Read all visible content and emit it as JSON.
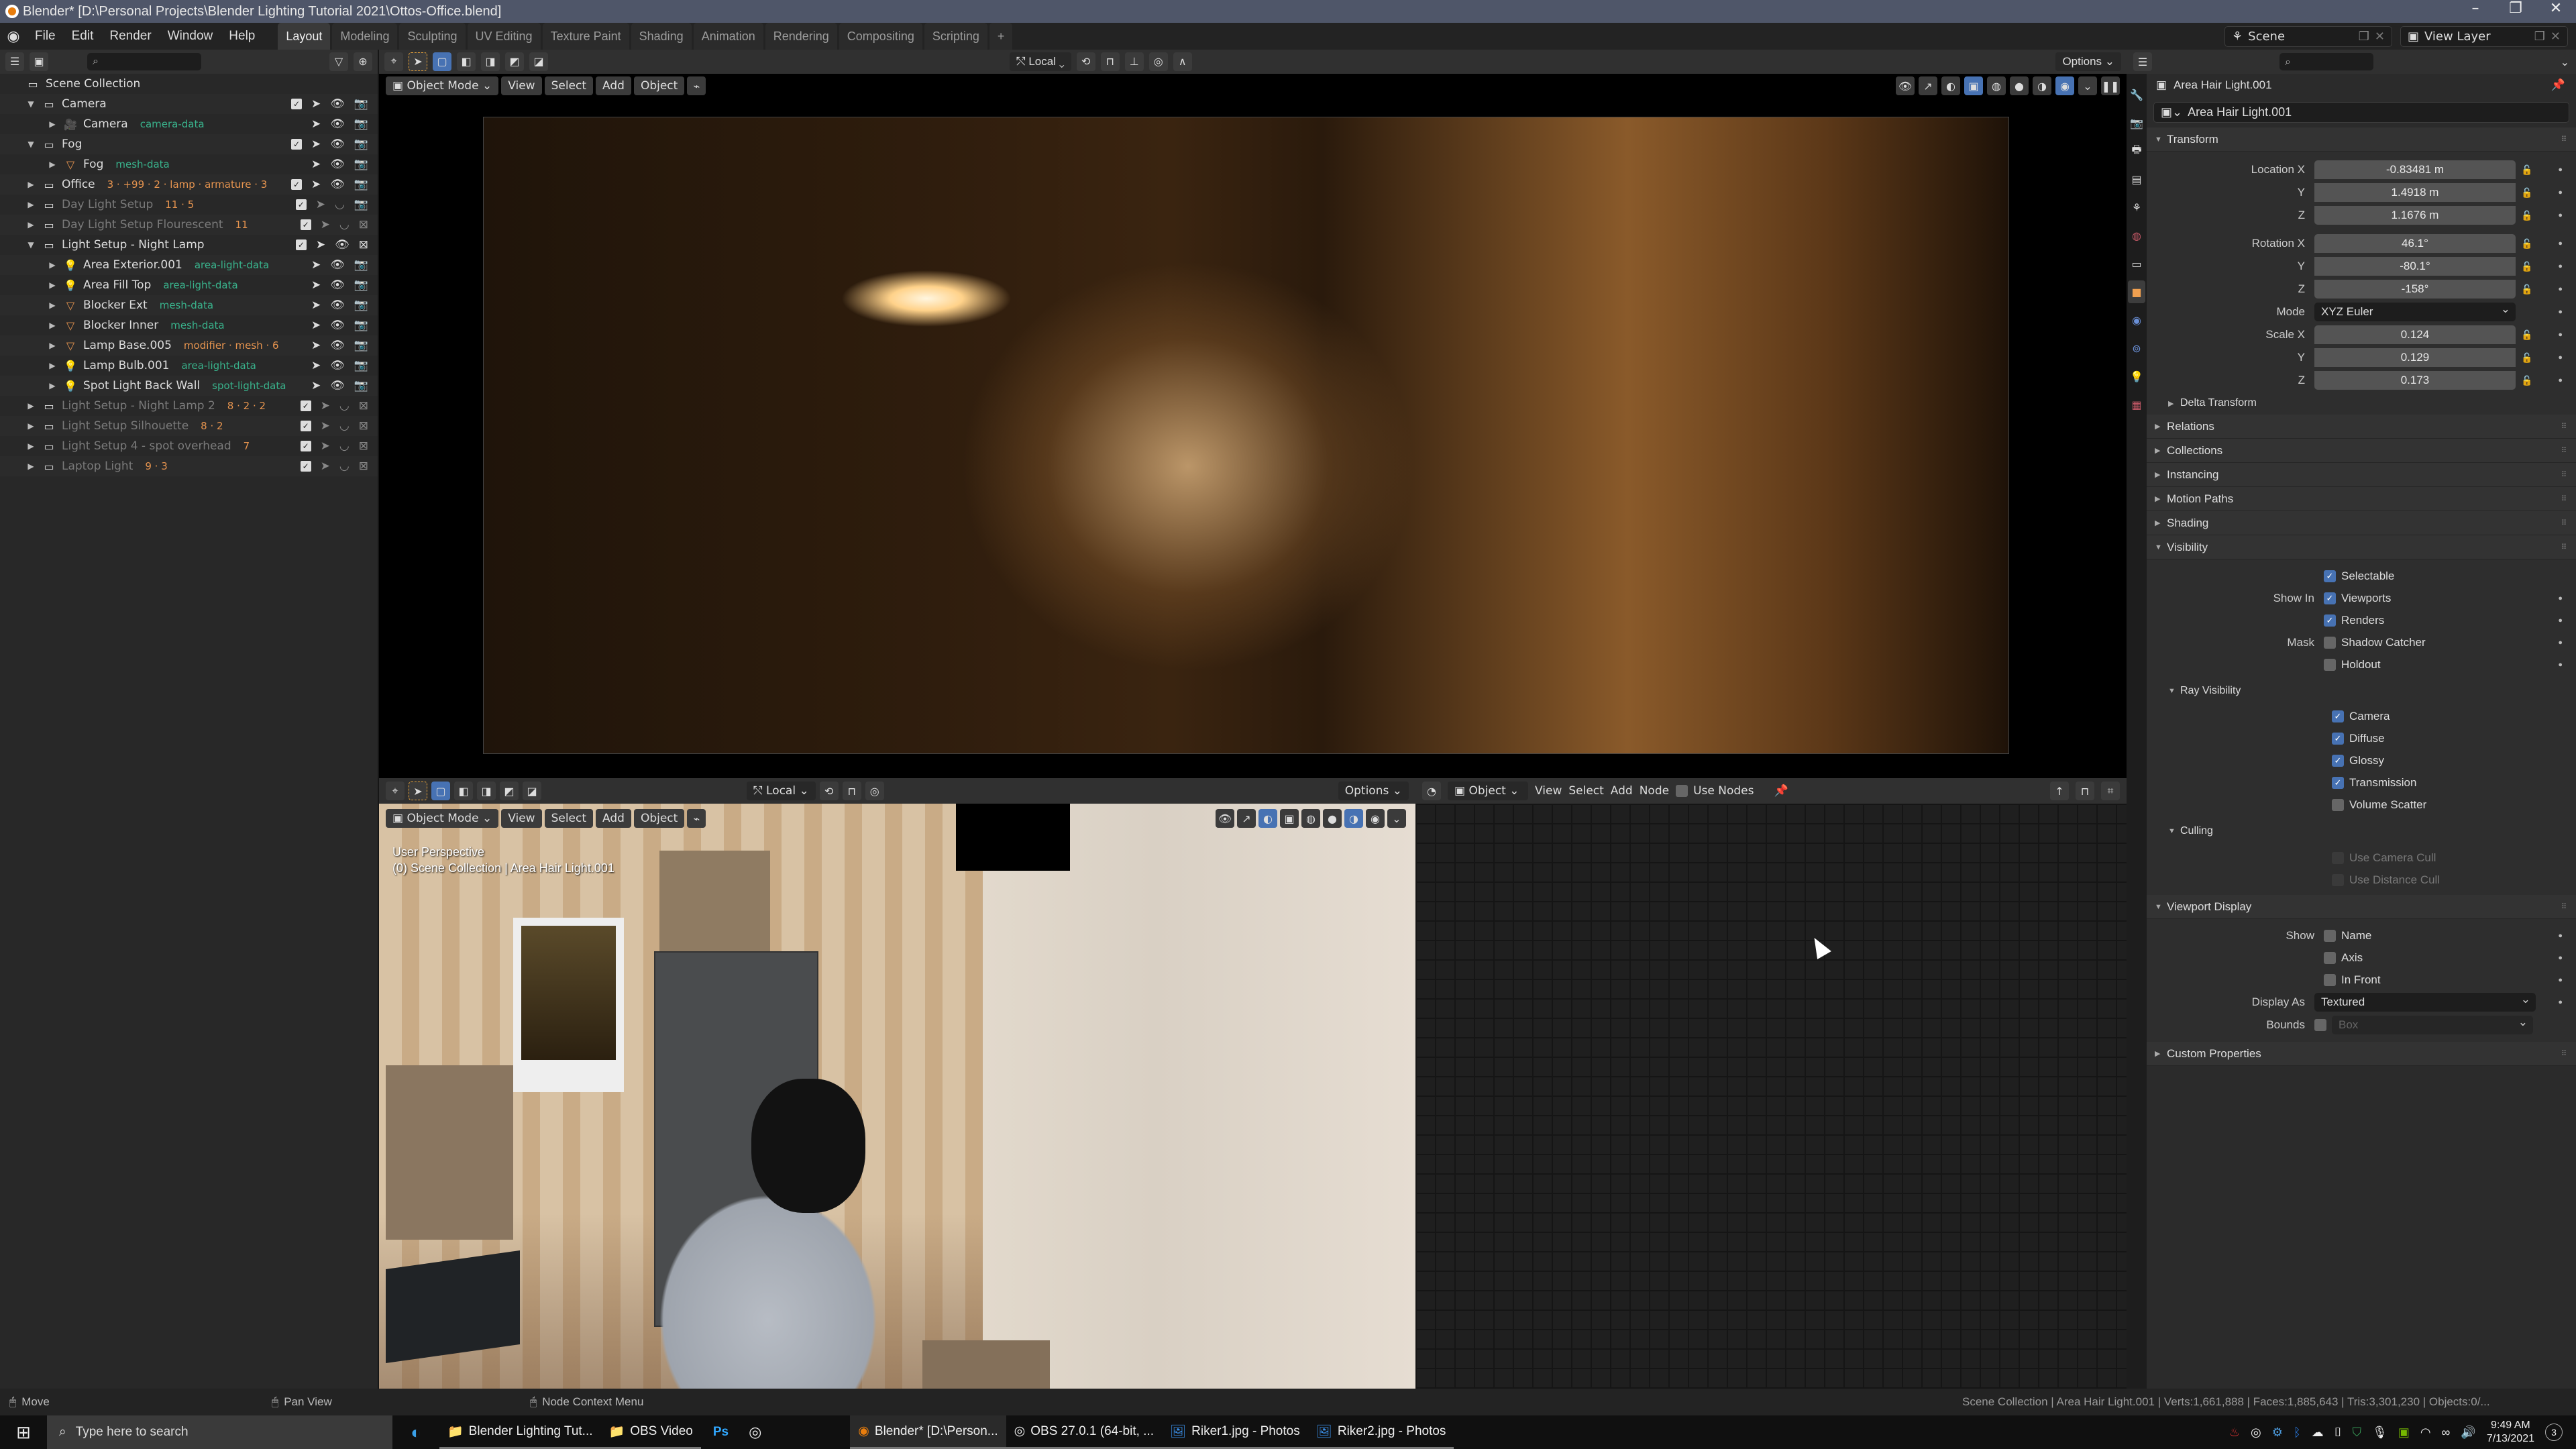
{
  "window": {
    "title": "Blender* [D:\\Personal Projects\\Blender Lighting Tutorial 2021\\Ottos-Office.blend]",
    "controls": [
      "–",
      "❐",
      "✕"
    ]
  },
  "menubar": {
    "menus": [
      "File",
      "Edit",
      "Render",
      "Window",
      "Help"
    ],
    "workspaces": [
      "Layout",
      "Modeling",
      "Sculpting",
      "UV Editing",
      "Texture Paint",
      "Shading",
      "Animation",
      "Rendering",
      "Compositing",
      "Scripting"
    ],
    "active_workspace": "Layout",
    "add_workspace": "+",
    "scene": "Scene",
    "view_layer": "View Layer"
  },
  "outliner": {
    "root": "Scene Collection",
    "rows": [
      {
        "label": "Camera",
        "type": "collection",
        "expand": "▼",
        "depth": 0,
        "dim": false,
        "badges": "",
        "checkbox": true,
        "render": "📷"
      },
      {
        "label": "Camera",
        "type": "camera",
        "expand": "▶",
        "depth": 1,
        "dim": false,
        "badges": "camera-data",
        "checkbox": false,
        "render": "📷"
      },
      {
        "label": "Fog",
        "type": "collection",
        "expand": "▼",
        "depth": 0,
        "dim": false,
        "badges": "",
        "checkbox": true,
        "render": "📷"
      },
      {
        "label": "Fog",
        "type": "mesh",
        "expand": "▶",
        "depth": 1,
        "dim": false,
        "badges": "mesh-data",
        "checkbox": false,
        "render": "📷"
      },
      {
        "label": "Office",
        "type": "collection",
        "expand": "▶",
        "depth": 0,
        "dim": false,
        "badges": "3 · +99 · 2 · lamp · armature · 3",
        "checkbox": true,
        "render": "📷"
      },
      {
        "label": "Day Light Setup",
        "type": "collection",
        "expand": "▶",
        "depth": 0,
        "dim": true,
        "badges": "11 · 5",
        "checkbox": true,
        "render": "📷"
      },
      {
        "label": "Day Light Setup Flourescent",
        "type": "collection",
        "expand": "▶",
        "depth": 0,
        "dim": true,
        "badges": "11",
        "checkbox": true,
        "render": "⊠"
      },
      {
        "label": "Light Setup - Night Lamp",
        "type": "collection",
        "expand": "▼",
        "depth": 0,
        "dim": false,
        "badges": "",
        "checkbox": true,
        "render": "⊠"
      },
      {
        "label": "Area Exterior.001",
        "type": "light",
        "expand": "▶",
        "depth": 1,
        "dim": false,
        "badges": "area-light-data",
        "checkbox": false,
        "render": "📷"
      },
      {
        "label": "Area Fill Top",
        "type": "light",
        "expand": "▶",
        "depth": 1,
        "dim": false,
        "badges": "area-light-data",
        "checkbox": false,
        "render": "📷"
      },
      {
        "label": "Blocker Ext",
        "type": "mesh",
        "expand": "▶",
        "depth": 1,
        "dim": false,
        "badges": "mesh-data",
        "checkbox": false,
        "render": "📷"
      },
      {
        "label": "Blocker Inner",
        "type": "mesh",
        "expand": "▶",
        "depth": 1,
        "dim": false,
        "badges": "mesh-data",
        "checkbox": false,
        "render": "📷"
      },
      {
        "label": "Lamp Base.005",
        "type": "mesh",
        "expand": "▶",
        "depth": 1,
        "dim": false,
        "badges": "modifier · mesh · 6",
        "checkbox": false,
        "render": "📷"
      },
      {
        "label": "Lamp Bulb.001",
        "type": "light",
        "expand": "▶",
        "depth": 1,
        "dim": false,
        "badges": "area-light-data",
        "checkbox": false,
        "render": "📷"
      },
      {
        "label": "Spot Light Back Wall",
        "type": "light",
        "expand": "▶",
        "depth": 1,
        "dim": false,
        "badges": "spot-light-data",
        "checkbox": false,
        "render": "📷"
      },
      {
        "label": "Light Setup - Night Lamp 2",
        "type": "collection",
        "expand": "▶",
        "depth": 0,
        "dim": true,
        "badges": "8 · 2 · 2",
        "checkbox": true,
        "render": "⊠"
      },
      {
        "label": "Light Setup Silhouette",
        "type": "collection",
        "expand": "▶",
        "depth": 0,
        "dim": true,
        "badges": "8 · 2",
        "checkbox": true,
        "render": "⊠"
      },
      {
        "label": "Light Setup 4 - spot overhead",
        "type": "collection",
        "expand": "▶",
        "depth": 0,
        "dim": true,
        "badges": "7",
        "checkbox": true,
        "render": "⊠"
      },
      {
        "label": "Laptop Light",
        "type": "collection",
        "expand": "▶",
        "depth": 0,
        "dim": true,
        "badges": "9 · 3",
        "checkbox": true,
        "render": "⊠"
      }
    ]
  },
  "top_viewport": {
    "transform_orientation": "Local",
    "options": "Options",
    "mode": "Object Mode",
    "menus": [
      "View",
      "Select",
      "Add",
      "Object"
    ],
    "shading_active": "rendered"
  },
  "bottom_viewport": {
    "transform_orientation": "Local",
    "options": "Options",
    "mode": "Object Mode",
    "menus": [
      "View",
      "Select",
      "Add",
      "Object"
    ],
    "overlay_line1": "User Perspective",
    "overlay_line2": "(0) Scene Collection | Area Hair Light.001",
    "shading_active": "material-preview"
  },
  "node_editor": {
    "type": "Object",
    "menus": [
      "View",
      "Select",
      "Add",
      "Node"
    ],
    "use_nodes_label": "Use Nodes",
    "use_nodes": false
  },
  "properties": {
    "object_name": "Area Hair Light.001",
    "datablock_name": "Area Hair Light.001",
    "transform": {
      "title": "Transform",
      "location_label": "Location X",
      "location": [
        "-0.83481 m",
        "1.4918 m",
        "1.1676 m"
      ],
      "rotation_label": "Rotation X",
      "rotation": [
        "46.1°",
        "-80.1°",
        "-158°"
      ],
      "mode_label": "Mode",
      "mode": "XYZ Euler",
      "scale_label": "Scale X",
      "scale": [
        "0.124",
        "0.129",
        "0.173"
      ],
      "axis_y": "Y",
      "axis_z": "Z"
    },
    "collapsed_sections": [
      "Delta Transform",
      "Relations",
      "Collections",
      "Instancing",
      "Motion Paths",
      "Shading"
    ],
    "visibility": {
      "title": "Visibility",
      "selectable": {
        "label": "Selectable",
        "checked": true
      },
      "show_in_label": "Show In",
      "viewports": {
        "label": "Viewports",
        "checked": true
      },
      "renders": {
        "label": "Renders",
        "checked": true
      },
      "mask_label": "Mask",
      "shadow_catcher": {
        "label": "Shadow Catcher",
        "checked": false
      },
      "holdout": {
        "label": "Holdout",
        "checked": false
      },
      "ray_visibility_title": "Ray Visibility",
      "ray": [
        {
          "label": "Camera",
          "checked": true
        },
        {
          "label": "Diffuse",
          "checked": true
        },
        {
          "label": "Glossy",
          "checked": true
        },
        {
          "label": "Transmission",
          "checked": true
        },
        {
          "label": "Volume Scatter",
          "checked": false
        }
      ],
      "culling_title": "Culling",
      "culling": [
        {
          "label": "Use Camera Cull",
          "checked": false
        },
        {
          "label": "Use Distance Cull",
          "checked": false
        }
      ]
    },
    "viewport_display": {
      "title": "Viewport Display",
      "show_label": "Show",
      "name": {
        "label": "Name",
        "checked": false
      },
      "axis": {
        "label": "Axis",
        "checked": false
      },
      "in_front": {
        "label": "In Front",
        "checked": false
      },
      "display_as_label": "Display As",
      "display_as": "Textured",
      "bounds_label": "Bounds",
      "bounds_checked": false,
      "bounds_type": "Box"
    },
    "custom_properties": "Custom Properties"
  },
  "statusbar": {
    "left_hint": "Move",
    "mid_hint": "Pan View",
    "right_hint": "Node Context Menu",
    "stats": "Scene Collection | Area Hair Light.001 | Verts:1,661,888 | Faces:1,885,643 | Tris:3,301,230 | Objects:0/..."
  },
  "taskbar": {
    "search_placeholder": "Type here to search",
    "apps": [
      {
        "label": "Blender Lighting Tut...",
        "icon": "folder-icon"
      },
      {
        "label": "OBS Video",
        "icon": "folder-icon"
      },
      {
        "label": "Blender* [D:\\Person...",
        "icon": "blender-icon",
        "active": true
      },
      {
        "label": "OBS 27.0.1 (64-bit, ...",
        "icon": "obs-icon"
      },
      {
        "label": "Riker1.jpg - Photos",
        "icon": "photos-icon"
      },
      {
        "label": "Riker2.jpg - Photos",
        "icon": "photos-icon"
      }
    ],
    "time": "9:49 AM",
    "date": "7/13/2021",
    "notifications": "3"
  },
  "colors": {
    "accent_blue": "#4772b3",
    "object_orange": "#e6944f",
    "data_green": "#39b38c",
    "title_bar": "#4f5669"
  }
}
